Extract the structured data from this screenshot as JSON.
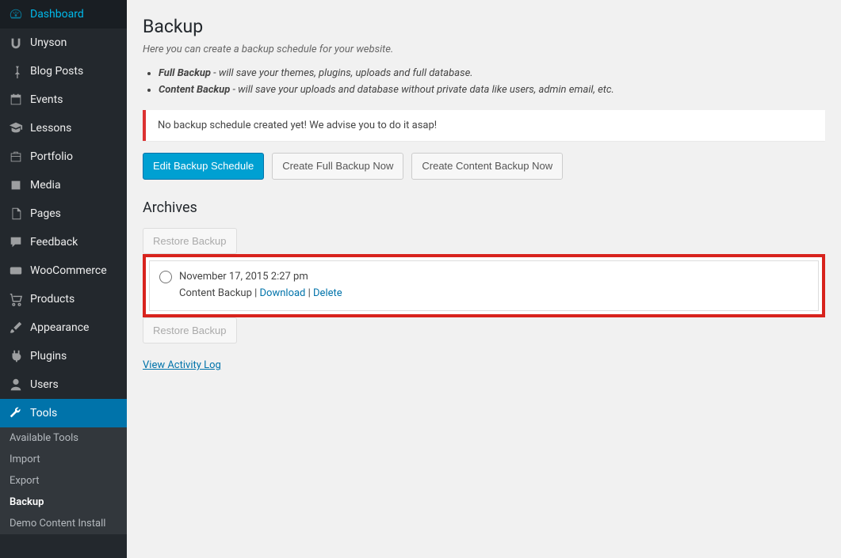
{
  "sidebar": {
    "items": [
      {
        "label": "Dashboard"
      },
      {
        "label": "Unyson"
      },
      {
        "label": "Blog Posts"
      },
      {
        "label": "Events"
      },
      {
        "label": "Lessons"
      },
      {
        "label": "Portfolio"
      },
      {
        "label": "Media"
      },
      {
        "label": "Pages"
      },
      {
        "label": "Feedback"
      },
      {
        "label": "WooCommerce"
      },
      {
        "label": "Products"
      },
      {
        "label": "Appearance"
      },
      {
        "label": "Plugins"
      },
      {
        "label": "Users"
      },
      {
        "label": "Tools"
      }
    ],
    "sub_items": [
      {
        "label": "Available Tools"
      },
      {
        "label": "Import"
      },
      {
        "label": "Export"
      },
      {
        "label": "Backup"
      },
      {
        "label": "Demo Content Install"
      }
    ]
  },
  "page": {
    "title": "Backup",
    "description": "Here you can create a backup schedule for your website.",
    "bullets": [
      {
        "strong": "Full Backup",
        "rest": " - will save your themes, plugins, uploads and full database."
      },
      {
        "strong": "Content Backup",
        "rest": " - will save your uploads and database without private data like users, admin email, etc."
      }
    ],
    "notice": "No backup schedule created yet! We advise you to do it asap!",
    "buttons": {
      "edit_schedule": "Edit Backup Schedule",
      "full_backup": "Create Full Backup Now",
      "content_backup": "Create Content Backup Now"
    },
    "archives_title": "Archives",
    "restore_label": "Restore Backup",
    "archive": {
      "date": "November 17, 2015 2:27 pm",
      "type": "Content Backup",
      "sep1": " | ",
      "download": "Download",
      "sep2": " | ",
      "delete": "Delete"
    },
    "view_log": "View Activity Log"
  }
}
